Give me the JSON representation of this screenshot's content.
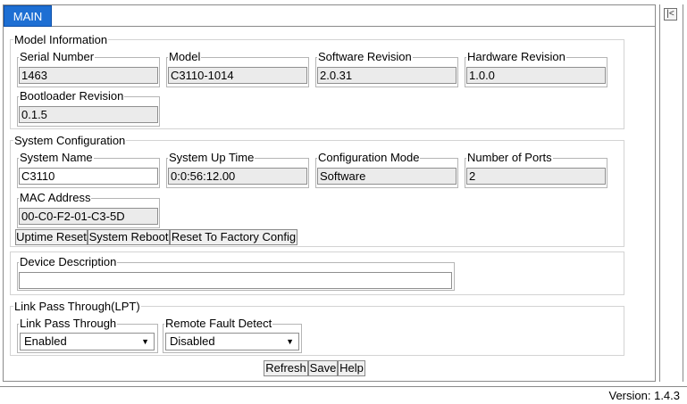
{
  "tab": {
    "label": "MAIN"
  },
  "sidebar": {
    "collapse_icon": "collapse-left-icon",
    "collapse_glyph": "|<"
  },
  "model_info": {
    "title": "Model Information",
    "serial_number": {
      "label": "Serial Number",
      "value": "1463"
    },
    "model": {
      "label": "Model",
      "value": "C3110-1014"
    },
    "software_revision": {
      "label": "Software Revision",
      "value": "2.0.31"
    },
    "hardware_revision": {
      "label": "Hardware Revision",
      "value": "1.0.0"
    },
    "bootloader_revision": {
      "label": "Bootloader Revision",
      "value": "0.1.5"
    }
  },
  "system_config": {
    "title": "System Configuration",
    "system_name": {
      "label": "System Name",
      "value": "C3110"
    },
    "system_up_time": {
      "label": "System Up Time",
      "value": "0:0:56:12.00"
    },
    "configuration_mode": {
      "label": "Configuration Mode",
      "value": "Software"
    },
    "number_of_ports": {
      "label": "Number of Ports",
      "value": "2"
    },
    "mac_address": {
      "label": "MAC Address",
      "value": "00-C0-F2-01-C3-5D"
    },
    "buttons": {
      "uptime_reset": "Uptime Reset",
      "system_reboot": "System Reboot",
      "reset_factory": "Reset To Factory Config"
    }
  },
  "device_description": {
    "label": "Device Description",
    "value": ""
  },
  "lpt": {
    "title": "Link Pass Through(LPT)",
    "link_pass_through": {
      "label": "Link Pass Through",
      "selected": "Enabled"
    },
    "remote_fault_detect": {
      "label": "Remote Fault Detect",
      "selected": "Disabled"
    }
  },
  "actions": {
    "refresh": "Refresh",
    "save": "Save",
    "help": "Help"
  },
  "footer": {
    "version": "Version: 1.4.3"
  }
}
